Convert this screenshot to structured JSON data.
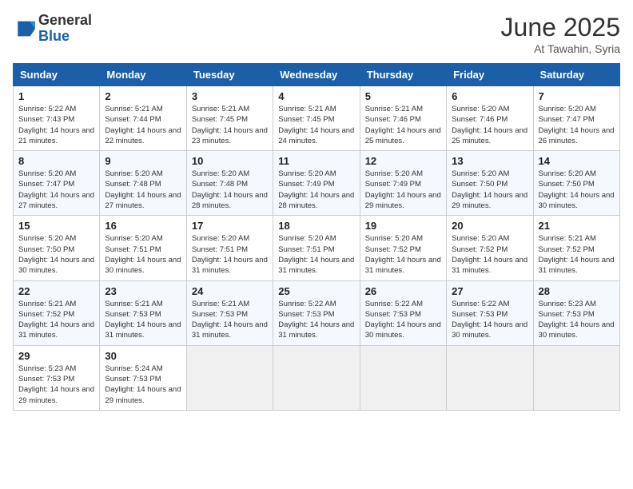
{
  "header": {
    "logo_general": "General",
    "logo_blue": "Blue",
    "month_title": "June 2025",
    "location": "At Tawahin, Syria"
  },
  "weekdays": [
    "Sunday",
    "Monday",
    "Tuesday",
    "Wednesday",
    "Thursday",
    "Friday",
    "Saturday"
  ],
  "weeks": [
    [
      {
        "day": "1",
        "sunrise": "Sunrise: 5:22 AM",
        "sunset": "Sunset: 7:43 PM",
        "daylight": "Daylight: 14 hours and 21 minutes."
      },
      {
        "day": "2",
        "sunrise": "Sunrise: 5:21 AM",
        "sunset": "Sunset: 7:44 PM",
        "daylight": "Daylight: 14 hours and 22 minutes."
      },
      {
        "day": "3",
        "sunrise": "Sunrise: 5:21 AM",
        "sunset": "Sunset: 7:45 PM",
        "daylight": "Daylight: 14 hours and 23 minutes."
      },
      {
        "day": "4",
        "sunrise": "Sunrise: 5:21 AM",
        "sunset": "Sunset: 7:45 PM",
        "daylight": "Daylight: 14 hours and 24 minutes."
      },
      {
        "day": "5",
        "sunrise": "Sunrise: 5:21 AM",
        "sunset": "Sunset: 7:46 PM",
        "daylight": "Daylight: 14 hours and 25 minutes."
      },
      {
        "day": "6",
        "sunrise": "Sunrise: 5:20 AM",
        "sunset": "Sunset: 7:46 PM",
        "daylight": "Daylight: 14 hours and 25 minutes."
      },
      {
        "day": "7",
        "sunrise": "Sunrise: 5:20 AM",
        "sunset": "Sunset: 7:47 PM",
        "daylight": "Daylight: 14 hours and 26 minutes."
      }
    ],
    [
      {
        "day": "8",
        "sunrise": "Sunrise: 5:20 AM",
        "sunset": "Sunset: 7:47 PM",
        "daylight": "Daylight: 14 hours and 27 minutes."
      },
      {
        "day": "9",
        "sunrise": "Sunrise: 5:20 AM",
        "sunset": "Sunset: 7:48 PM",
        "daylight": "Daylight: 14 hours and 27 minutes."
      },
      {
        "day": "10",
        "sunrise": "Sunrise: 5:20 AM",
        "sunset": "Sunset: 7:48 PM",
        "daylight": "Daylight: 14 hours and 28 minutes."
      },
      {
        "day": "11",
        "sunrise": "Sunrise: 5:20 AM",
        "sunset": "Sunset: 7:49 PM",
        "daylight": "Daylight: 14 hours and 28 minutes."
      },
      {
        "day": "12",
        "sunrise": "Sunrise: 5:20 AM",
        "sunset": "Sunset: 7:49 PM",
        "daylight": "Daylight: 14 hours and 29 minutes."
      },
      {
        "day": "13",
        "sunrise": "Sunrise: 5:20 AM",
        "sunset": "Sunset: 7:50 PM",
        "daylight": "Daylight: 14 hours and 29 minutes."
      },
      {
        "day": "14",
        "sunrise": "Sunrise: 5:20 AM",
        "sunset": "Sunset: 7:50 PM",
        "daylight": "Daylight: 14 hours and 30 minutes."
      }
    ],
    [
      {
        "day": "15",
        "sunrise": "Sunrise: 5:20 AM",
        "sunset": "Sunset: 7:50 PM",
        "daylight": "Daylight: 14 hours and 30 minutes."
      },
      {
        "day": "16",
        "sunrise": "Sunrise: 5:20 AM",
        "sunset": "Sunset: 7:51 PM",
        "daylight": "Daylight: 14 hours and 30 minutes."
      },
      {
        "day": "17",
        "sunrise": "Sunrise: 5:20 AM",
        "sunset": "Sunset: 7:51 PM",
        "daylight": "Daylight: 14 hours and 31 minutes."
      },
      {
        "day": "18",
        "sunrise": "Sunrise: 5:20 AM",
        "sunset": "Sunset: 7:51 PM",
        "daylight": "Daylight: 14 hours and 31 minutes."
      },
      {
        "day": "19",
        "sunrise": "Sunrise: 5:20 AM",
        "sunset": "Sunset: 7:52 PM",
        "daylight": "Daylight: 14 hours and 31 minutes."
      },
      {
        "day": "20",
        "sunrise": "Sunrise: 5:20 AM",
        "sunset": "Sunset: 7:52 PM",
        "daylight": "Daylight: 14 hours and 31 minutes."
      },
      {
        "day": "21",
        "sunrise": "Sunrise: 5:21 AM",
        "sunset": "Sunset: 7:52 PM",
        "daylight": "Daylight: 14 hours and 31 minutes."
      }
    ],
    [
      {
        "day": "22",
        "sunrise": "Sunrise: 5:21 AM",
        "sunset": "Sunset: 7:52 PM",
        "daylight": "Daylight: 14 hours and 31 minutes."
      },
      {
        "day": "23",
        "sunrise": "Sunrise: 5:21 AM",
        "sunset": "Sunset: 7:53 PM",
        "daylight": "Daylight: 14 hours and 31 minutes."
      },
      {
        "day": "24",
        "sunrise": "Sunrise: 5:21 AM",
        "sunset": "Sunset: 7:53 PM",
        "daylight": "Daylight: 14 hours and 31 minutes."
      },
      {
        "day": "25",
        "sunrise": "Sunrise: 5:22 AM",
        "sunset": "Sunset: 7:53 PM",
        "daylight": "Daylight: 14 hours and 31 minutes."
      },
      {
        "day": "26",
        "sunrise": "Sunrise: 5:22 AM",
        "sunset": "Sunset: 7:53 PM",
        "daylight": "Daylight: 14 hours and 30 minutes."
      },
      {
        "day": "27",
        "sunrise": "Sunrise: 5:22 AM",
        "sunset": "Sunset: 7:53 PM",
        "daylight": "Daylight: 14 hours and 30 minutes."
      },
      {
        "day": "28",
        "sunrise": "Sunrise: 5:23 AM",
        "sunset": "Sunset: 7:53 PM",
        "daylight": "Daylight: 14 hours and 30 minutes."
      }
    ],
    [
      {
        "day": "29",
        "sunrise": "Sunrise: 5:23 AM",
        "sunset": "Sunset: 7:53 PM",
        "daylight": "Daylight: 14 hours and 29 minutes."
      },
      {
        "day": "30",
        "sunrise": "Sunrise: 5:24 AM",
        "sunset": "Sunset: 7:53 PM",
        "daylight": "Daylight: 14 hours and 29 minutes."
      },
      null,
      null,
      null,
      null,
      null
    ]
  ]
}
